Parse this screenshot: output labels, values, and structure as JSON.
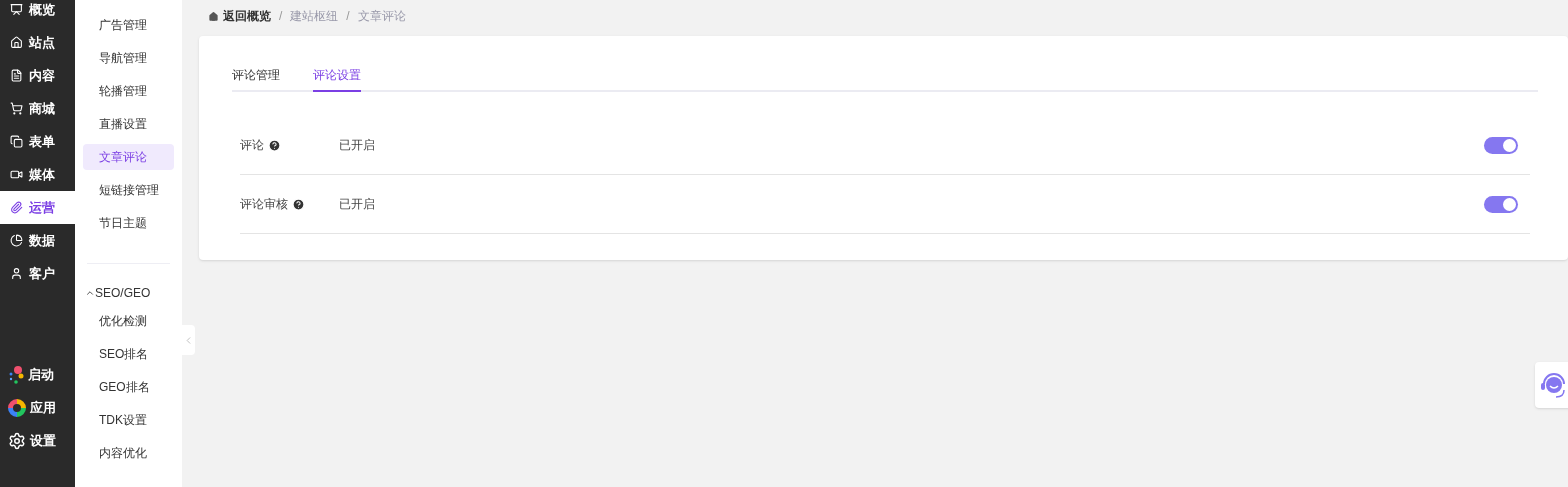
{
  "nav": [
    {
      "label": "概览",
      "selected": false
    },
    {
      "label": "站点",
      "selected": false
    },
    {
      "label": "内容",
      "selected": false
    },
    {
      "label": "商城",
      "selected": false
    },
    {
      "label": "表单",
      "selected": false
    },
    {
      "label": "媒体",
      "selected": false
    },
    {
      "label": "运营",
      "selected": true
    },
    {
      "label": "数据",
      "selected": false
    },
    {
      "label": "客户",
      "selected": false
    }
  ],
  "nav_bottom": [
    {
      "label": "启动"
    },
    {
      "label": "应用"
    },
    {
      "label": "设置"
    }
  ],
  "submenu": [
    {
      "label": "广告管理",
      "selected": false
    },
    {
      "label": "导航管理",
      "selected": false
    },
    {
      "label": "轮播管理",
      "selected": false
    },
    {
      "label": "直播设置",
      "selected": false
    },
    {
      "label": "文章评论",
      "selected": true
    },
    {
      "label": "短链接管理",
      "selected": false
    },
    {
      "label": "节日主题",
      "selected": false
    }
  ],
  "submenu_group": {
    "title": "SEO/GEO",
    "expanded": true,
    "items": [
      {
        "label": "优化检测"
      },
      {
        "label": "SEO排名"
      },
      {
        "label": "GEO排名"
      },
      {
        "label": "TDK设置"
      },
      {
        "label": "内容优化"
      }
    ]
  },
  "breadcrumb": [
    "返回概览",
    "建站枢纽",
    "文章评论"
  ],
  "breadcrumb_separator": "/",
  "tabs": [
    {
      "label": "评论管理",
      "selected": false
    },
    {
      "label": "评论设置",
      "selected": true
    }
  ],
  "settings": [
    {
      "label": "评论",
      "status": "已开启",
      "on": true
    },
    {
      "label": "评论审核",
      "status": "已开启",
      "on": true
    }
  ]
}
